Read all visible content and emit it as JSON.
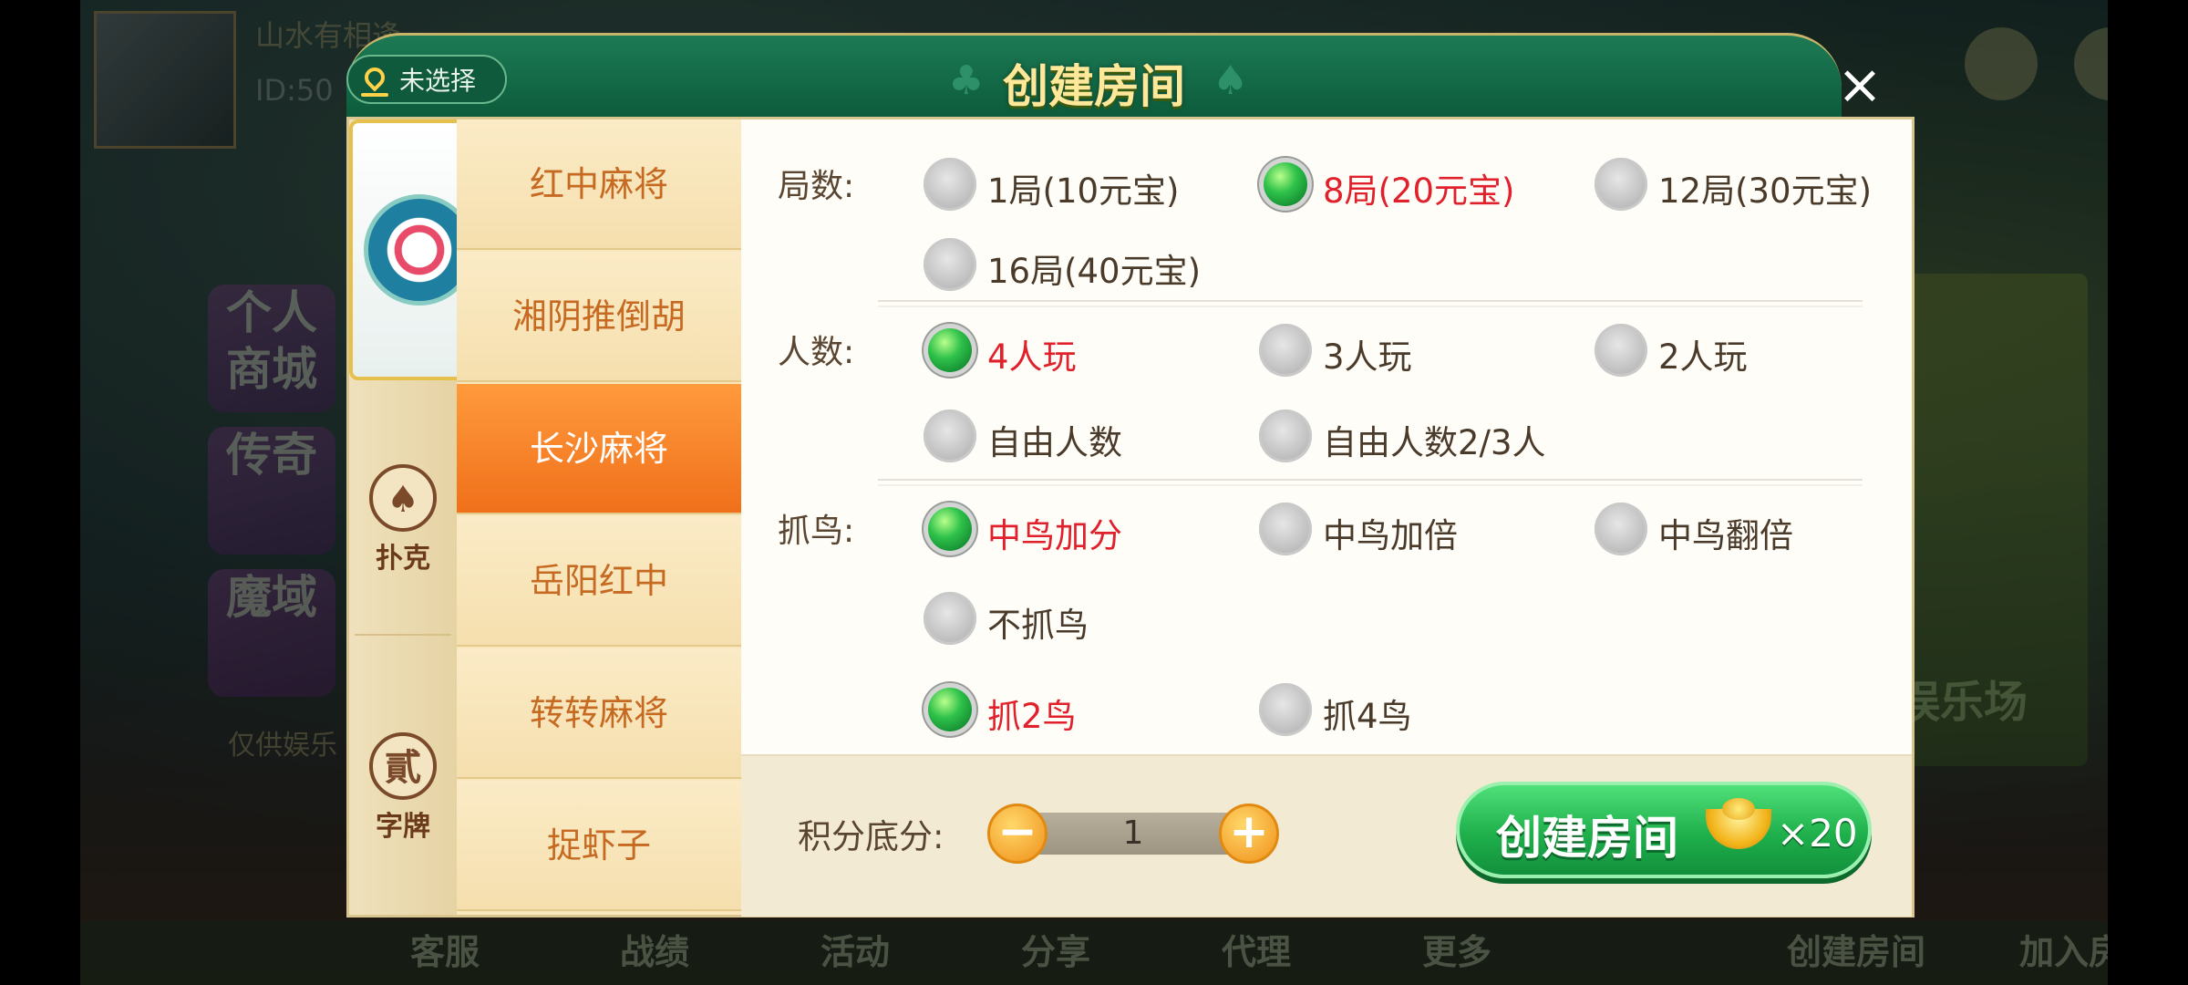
{
  "background": {
    "player_name": "山水有相逢",
    "player_id": "ID:50",
    "tiles": [
      "个人商城",
      "传奇",
      "魔域"
    ],
    "disclaimer": "仅供娱乐",
    "right_panel_text": "娱乐场",
    "bottom_buttons": [
      "客服",
      "战绩",
      "活动",
      "分享",
      "代理",
      "更多",
      "创建房间",
      "加入房间"
    ]
  },
  "dialog": {
    "title": "创建房间",
    "location_label": "未选择",
    "close_label": "×",
    "categories": [
      {
        "label": "",
        "icon": "mahjong-icon",
        "active": true
      },
      {
        "label": "扑克",
        "icon": "spade-icon",
        "glyph": "♠",
        "active": false
      },
      {
        "label": "字牌",
        "icon": "zipai-icon",
        "glyph": "貳",
        "active": false
      }
    ],
    "games": [
      {
        "label": "红中麻将",
        "selected": false
      },
      {
        "label": "湘阴推倒胡",
        "selected": false
      },
      {
        "label": "长沙麻将",
        "selected": true
      },
      {
        "label": "岳阳红中",
        "selected": false
      },
      {
        "label": "转转麻将",
        "selected": false
      },
      {
        "label": "捉虾子",
        "selected": false
      }
    ],
    "options": {
      "rounds": {
        "label": "局数:",
        "choices": [
          {
            "text": "1局(10元宝)",
            "selected": false
          },
          {
            "text": "8局(20元宝)",
            "selected": true
          },
          {
            "text": "12局(30元宝)",
            "selected": false
          },
          {
            "text": "16局(40元宝)",
            "selected": false
          }
        ]
      },
      "players": {
        "label": "人数:",
        "choices": [
          {
            "text": "4人玩",
            "selected": true
          },
          {
            "text": "3人玩",
            "selected": false
          },
          {
            "text": "2人玩",
            "selected": false
          },
          {
            "text": "自由人数",
            "selected": false
          },
          {
            "text": "自由人数2/3人",
            "selected": false
          }
        ]
      },
      "bird": {
        "label": "抓鸟:",
        "choices": [
          {
            "text": "中鸟加分",
            "selected": true
          },
          {
            "text": "中鸟加倍",
            "selected": false
          },
          {
            "text": "中鸟翻倍",
            "selected": false
          },
          {
            "text": "不抓鸟",
            "selected": false
          }
        ],
        "count_choices": [
          {
            "text": "抓2鸟",
            "selected": true
          },
          {
            "text": "抓4鸟",
            "selected": false
          }
        ]
      }
    },
    "score": {
      "label": "积分底分:",
      "value": "1",
      "minus": "−",
      "plus": "+"
    },
    "create_button": {
      "label": "创建房间",
      "cost": "×20",
      "icon": "gold-ingot-icon"
    },
    "colors": {
      "header_green": "#0c5a3a",
      "selected_text": "#e0202a",
      "selected_tab": "#f0701a",
      "create_button": "#1fb04c"
    }
  }
}
